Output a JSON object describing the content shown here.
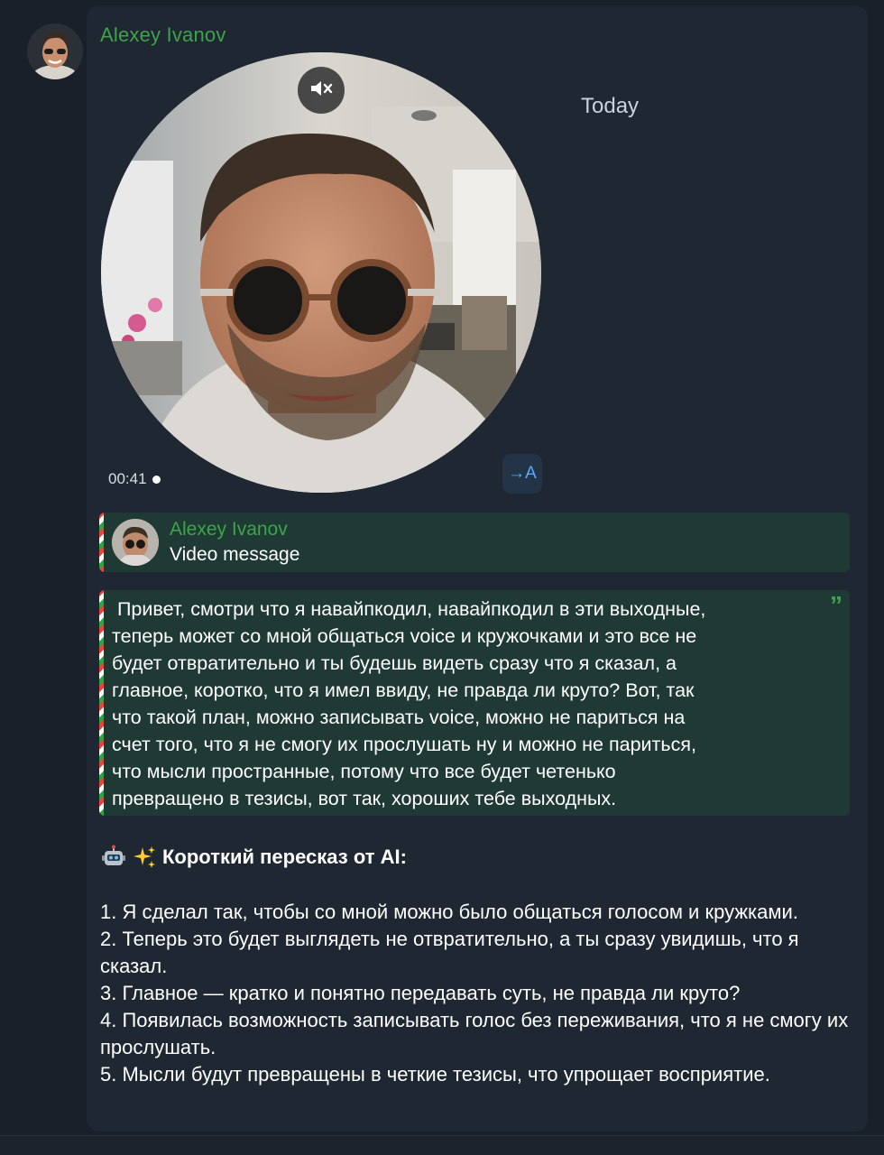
{
  "message": {
    "sender_name": "Alexey Ivanov",
    "date_label": "Today",
    "video": {
      "duration": "00:41",
      "mute_icon": "speaker-mute-icon",
      "translate_label": "→A"
    },
    "reply": {
      "name": "Alexey Ivanov",
      "label": "Video message"
    },
    "transcript": "Привет, смотри что я навайпкодил, навайпкодил в эти выходные, теперь может со мной общаться voice и кружочками и это все не будет отвратительно и ты будешь видеть сразу что я сказал, а главное, коротко, что я имел ввиду, не правда ли круто? Вот, так что такой план, можно записывать voice, можно не париться на счет того, что я не смогу их прослушать ну и можно не париться, что мысли пространные, потому что все будет четенько превращено в тезисы, вот так, хороших тебе выходных.",
    "transcript_lines": [
      " Привет, смотри что я навайпкодил, навайпкодил в эти выходные,",
      "теперь может со мной общаться voice и кружочками и это все не",
      "будет отвратительно и ты будешь видеть сразу что я сказал, а",
      "главное, коротко, что я имел ввиду, не правда ли круто? Вот, так",
      "что такой план, можно записывать voice, можно не париться на",
      "счет того, что я не смогу их прослушать ну и можно не париться,",
      "что мысли пространные, потому что все будет четенько",
      "превращено в тезисы, вот так, хороших тебе выходных."
    ],
    "quote_mark": "”",
    "summary": {
      "emoji_robot": "🤖",
      "emoji_sparkles": "✨",
      "title": "Короткий пересказ от AI:",
      "items": [
        "1. Я сделал так, чтобы со мной можно было общаться голосом и кружками.",
        "2. Теперь это будет выглядеть не отвратительно, а ты сразу увидишь, что я сказал.",
        "3. Главное — кратко и понятно передавать суть, не правда ли круто?",
        "4. Появилась возможность записывать голос без переживания, что я не смогу их прослушать.",
        "5. Мысли будут превращены в четкие тезисы, что упрощает восприятие."
      ]
    }
  },
  "colors": {
    "background": "#19202a",
    "card": "#1e2732",
    "name_green": "#3ea34a",
    "quote_bg": "#1f3a34",
    "translate_blue": "#5aa7ff"
  }
}
